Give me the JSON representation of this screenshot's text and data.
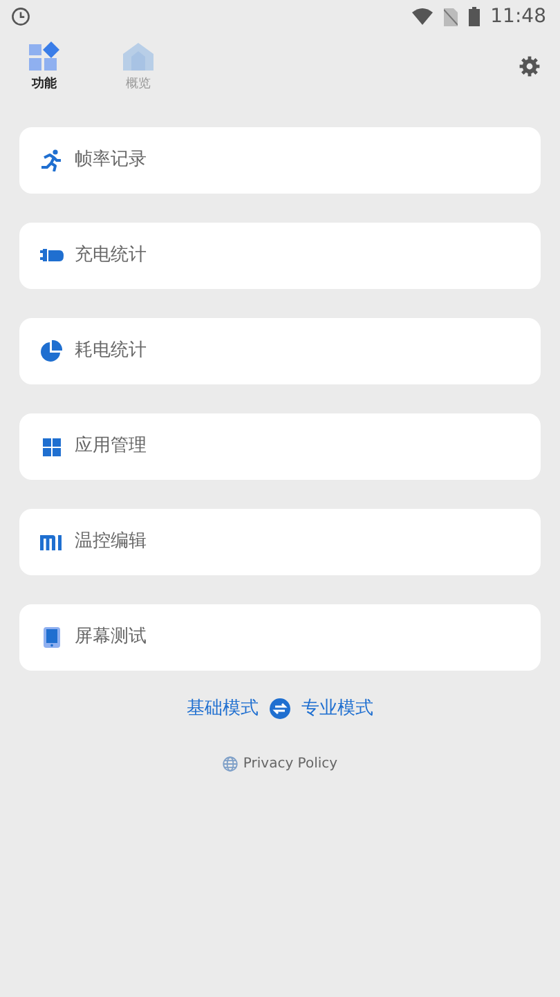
{
  "status_bar": {
    "time": "11:48"
  },
  "tabs": [
    {
      "label": "功能",
      "kind": "features",
      "selected": true
    },
    {
      "label": "概览",
      "kind": "overview",
      "selected": false
    }
  ],
  "menu_items": [
    {
      "label": "帧率记录",
      "kind": "runner"
    },
    {
      "label": "充电统计",
      "kind": "plug"
    },
    {
      "label": "耗电统计",
      "kind": "pie"
    },
    {
      "label": "应用管理",
      "kind": "grid"
    },
    {
      "label": "温控编辑",
      "kind": "mi"
    },
    {
      "label": "屏幕测试",
      "kind": "tablet"
    }
  ],
  "mode_switch": {
    "left": "基础模式",
    "right": "专业模式"
  },
  "privacy_link": "Privacy Policy"
}
